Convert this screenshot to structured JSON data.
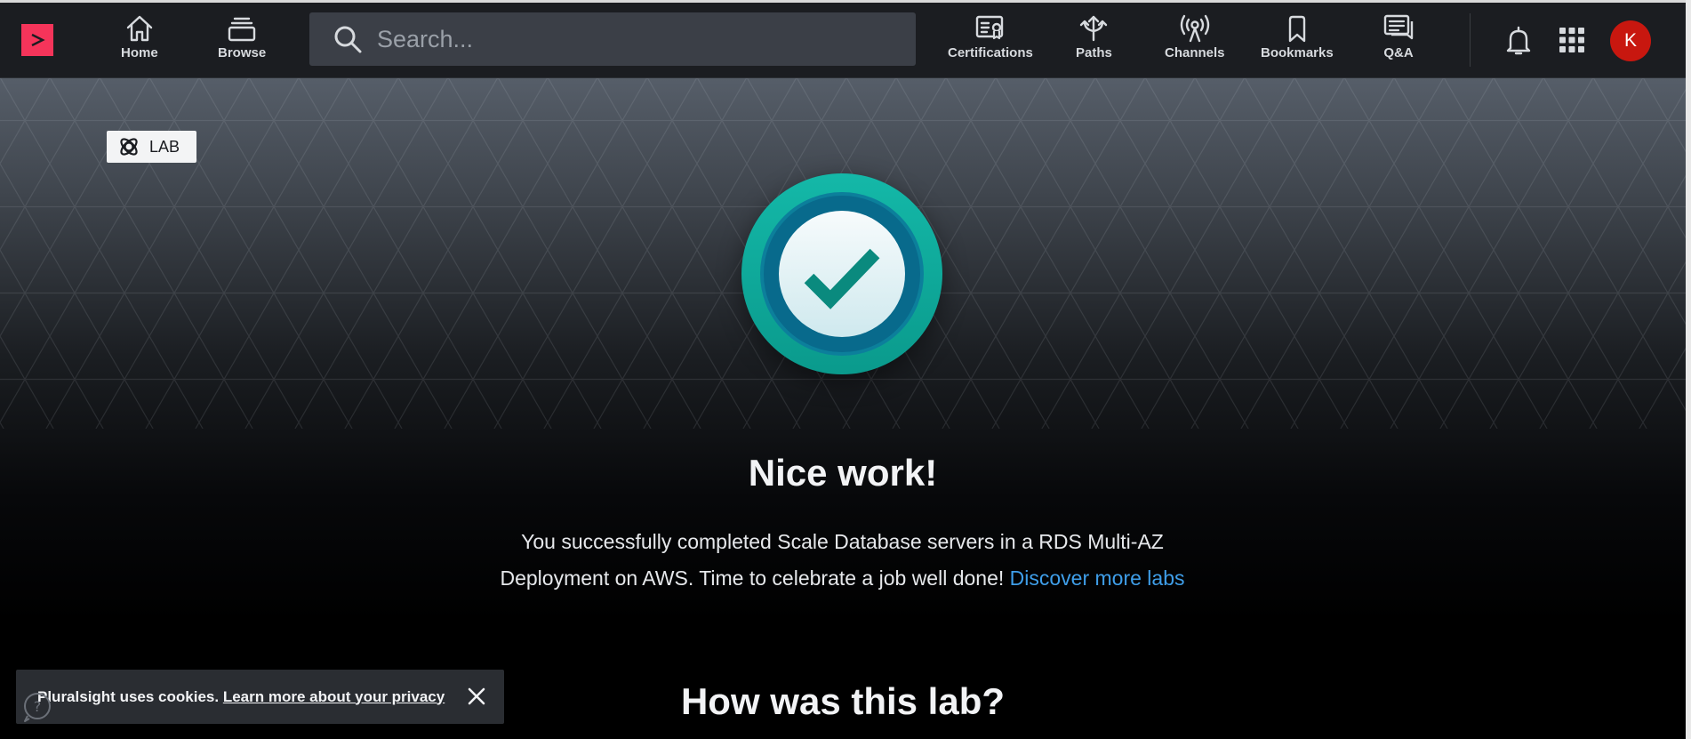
{
  "nav": {
    "logo_icon": "pluralsight-play-logo",
    "home_label": "Home",
    "browse_label": "Browse",
    "search_placeholder": "Search...",
    "certifications_label": "Certifications",
    "paths_label": "Paths",
    "channels_label": "Channels",
    "bookmarks_label": "Bookmarks",
    "qa_label": "Q&A",
    "notifications_icon": "bell-icon",
    "apps_icon": "grid-icon",
    "avatar_initial": "K",
    "avatar_color": "#c8170f"
  },
  "lab_badge": {
    "label": "LAB"
  },
  "completion": {
    "icon": "checkmark-icon",
    "headline": "Nice work!",
    "message_line1": "You successfully completed Scale Database servers in a RDS Multi-AZ",
    "message_line2": "Deployment on AWS. Time to celebrate a job well done!",
    "discover_link": "Discover more labs",
    "link_color": "#3f9ee9"
  },
  "feedback": {
    "question": "How was this lab?"
  },
  "cookie_banner": {
    "text": "Pluralsight uses cookies.",
    "link": "Learn more about your privacy",
    "close_icon": "close-icon"
  },
  "colors": {
    "brand": "#f5345a",
    "navbar": "#1b1d21",
    "badge_teal": "#0fa89b"
  }
}
